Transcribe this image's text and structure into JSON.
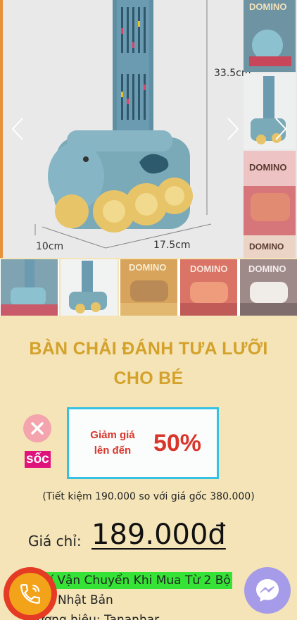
{
  "gallery": {
    "main_dimensions": {
      "height": "33.5cm",
      "width": "10cm",
      "length": "17.5cm"
    },
    "logo_text": "DOMINO"
  },
  "product": {
    "title_line1": "BÀN CHẢI ĐÁNH TƯA LƯỠI",
    "title_line2": "CHO BÉ"
  },
  "promo": {
    "shock_label": "sốc",
    "discount_label": "Giảm giá lên đến",
    "discount_value": "50%",
    "saving_text": "(Tiết kiệm 190.000 so với giá gốc 380.000)"
  },
  "price": {
    "label": "Giá chỉ:",
    "value": "189.000đ"
  },
  "features": {
    "shipping": "n Phí Vận Chuyển Khi Mua Từ 2 Bộ",
    "origin": "xứ: Nhật Bản",
    "brand": "ương hiệu: Tananhar"
  },
  "colors": {
    "title": "#d4a22a",
    "background": "#f4e4b8",
    "discount_border": "#35c1e3",
    "discount_text": "#d9362b",
    "shock_tag": "#e0127b",
    "shipping_highlight": "#35e337",
    "call_button": "#e53a23",
    "messenger_button": "#a69be8"
  }
}
